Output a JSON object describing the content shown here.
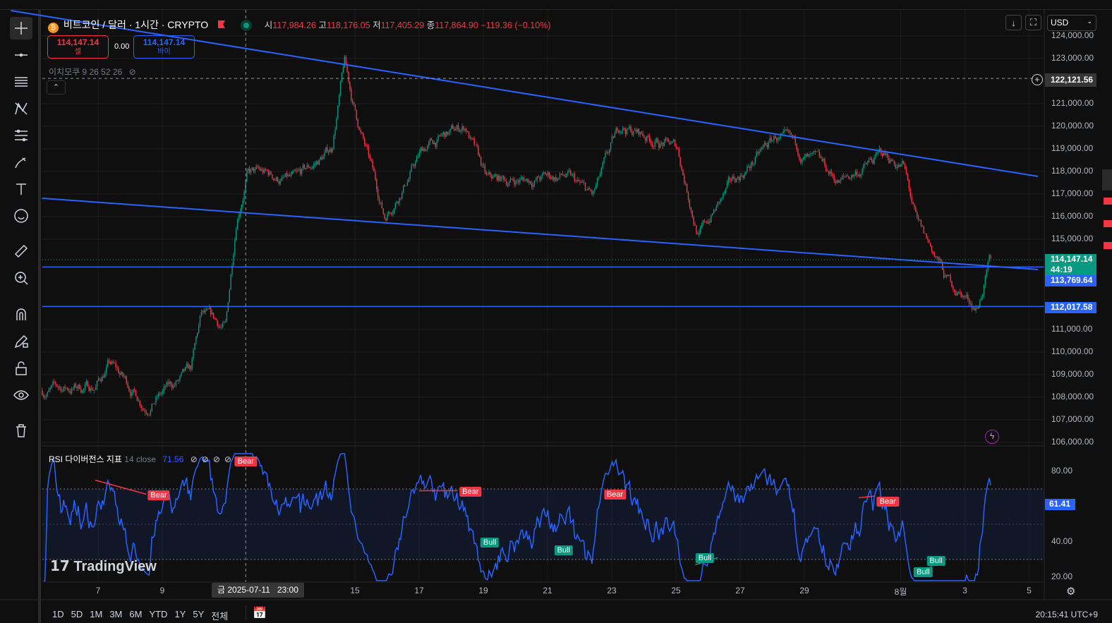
{
  "symbol": {
    "title": "비트코인 / 달러 · 1시간 · CRYPTO",
    "o_label": "시",
    "o": "117,984.26",
    "h_label": "고",
    "h": "118,176.05",
    "l_label": "저",
    "l": "117,405.29",
    "c_label": "종",
    "c": "117,864.90",
    "change": "−119.36 (−0.10%)"
  },
  "trade": {
    "sell_price": "114,147.14",
    "sell_label": "셀",
    "spread": "0.00",
    "buy_price": "114,147.14",
    "buy_label": "바이"
  },
  "ichimoku": "이치모쿠 9 26 52 26",
  "currency": "USD",
  "price_axis": {
    "ticks": [
      "124,000.00",
      "123,000.00",
      "121,000.00",
      "120,000.00",
      "119,000.00",
      "118,000.00",
      "117,000.00",
      "116,000.00",
      "115,000.00",
      "111,000.00",
      "110,000.00",
      "109,000.00",
      "108,000.00",
      "107,000.00",
      "106,000.00"
    ],
    "tick_values": [
      124000,
      123000,
      121000,
      120000,
      119000,
      118000,
      117000,
      116000,
      115000,
      111000,
      110000,
      109000,
      108000,
      107000,
      106000
    ],
    "crosshair_price": "122,121.56",
    "crosshair_value": 122121.56,
    "last_price": "114,147.14",
    "countdown": "44:19",
    "last_value": 114147.14,
    "hline1": "113,769.64",
    "hline1_value": 113769.64,
    "hline2": "112,017.58",
    "hline2_value": 112017.58
  },
  "rsi": {
    "title": "RSI 다이버전스 지표",
    "params": "14 close",
    "value": "71.56",
    "last": "61.41",
    "ticks": [
      "80.00",
      "40.00",
      "20.00"
    ],
    "tick_values": [
      80,
      40,
      20
    ],
    "signals": [
      {
        "type": "Bear",
        "day": 8.89,
        "value": 66.4
      },
      {
        "type": "Bear",
        "day": 11.6,
        "value": 85.5
      },
      {
        "type": "Bear",
        "day": 18.6,
        "value": 68.4
      },
      {
        "type": "Bear",
        "day": 23.1,
        "value": 66.8
      },
      {
        "type": "Bear",
        "day": 31.6,
        "value": 62.8
      },
      {
        "type": "Bull",
        "day": 19.2,
        "value": 39.6
      },
      {
        "type": "Bull",
        "day": 21.5,
        "value": 35.2
      },
      {
        "type": "Bull",
        "day": 25.9,
        "value": 30.8
      },
      {
        "type": "Bull",
        "day": 33.1,
        "value": 29.2
      },
      {
        "type": "Bull",
        "day": 32.7,
        "value": 22.8
      }
    ]
  },
  "x_axis": {
    "labels": [
      {
        "t": "7",
        "day": 7
      },
      {
        "t": "9",
        "day": 9
      },
      {
        "t": "15",
        "day": 15
      },
      {
        "t": "17",
        "day": 17
      },
      {
        "t": "19",
        "day": 19
      },
      {
        "t": "21",
        "day": 21
      },
      {
        "t": "23",
        "day": 23
      },
      {
        "t": "25",
        "day": 25
      },
      {
        "t": "27",
        "day": 27
      },
      {
        "t": "29",
        "day": 29
      },
      {
        "t": "8월",
        "day": 32
      },
      {
        "t": "3",
        "day": 34
      },
      {
        "t": "5",
        "day": 36
      }
    ],
    "crosshair": "금 2025-07-11   23:00",
    "crosshair_day": 11.6
  },
  "ranges": [
    "1D",
    "5D",
    "1M",
    "3M",
    "6M",
    "YTD",
    "1Y",
    "5Y",
    "전체"
  ],
  "clock": "20:15:41 UTC+9",
  "watermark": "TradingView",
  "price_path": [
    [
      5.26,
      108300
    ],
    [
      6.91,
      108500
    ],
    [
      7.35,
      109500
    ],
    [
      8.45,
      107700
    ],
    [
      9.88,
      109000
    ],
    [
      10.21,
      111500
    ],
    [
      10.98,
      111000
    ],
    [
      11.31,
      116000
    ],
    [
      11.64,
      118000
    ],
    [
      13.18,
      117500
    ],
    [
      14.27,
      119000
    ],
    [
      14.67,
      122800
    ],
    [
      14.93,
      121000
    ],
    [
      15.92,
      116000
    ],
    [
      17.13,
      119000
    ],
    [
      18.45,
      120000
    ],
    [
      19.11,
      117500
    ],
    [
      21.53,
      117800
    ],
    [
      22.41,
      116800
    ],
    [
      23.29,
      120000
    ],
    [
      25.04,
      119000
    ],
    [
      25.7,
      115200
    ],
    [
      26.8,
      117500
    ],
    [
      28.12,
      119500
    ],
    [
      30.1,
      117500
    ],
    [
      31.42,
      118700
    ],
    [
      32.08,
      118300
    ],
    [
      32.52,
      115500
    ],
    [
      33.18,
      114000
    ],
    [
      33.4,
      113200
    ],
    [
      34.38,
      112000
    ],
    [
      34.82,
      114147.14
    ]
  ],
  "trendlines": [
    {
      "from": [
        4.28,
        125125
      ],
      "to": [
        36.28,
        117781
      ]
    },
    {
      "from": [
        5.26,
        116812
      ],
      "to": [
        36.28,
        113656
      ]
    }
  ],
  "colors": {
    "up": "#089981",
    "down": "#f23645",
    "line": "#2962ff",
    "rsi": "#2962ff",
    "bg": "#0f0f0f"
  }
}
